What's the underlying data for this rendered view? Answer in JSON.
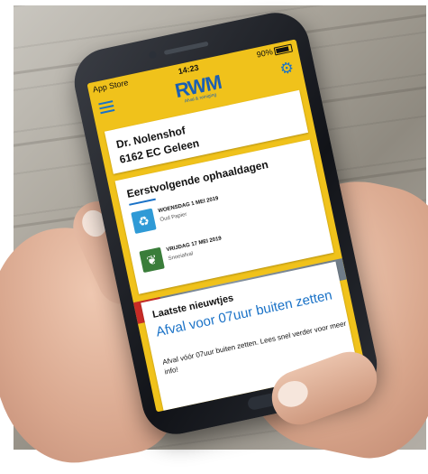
{
  "status_bar": {
    "carrier": "App Store",
    "time": "14:23",
    "battery": "90%"
  },
  "app": {
    "logo_text": "RWM",
    "logo_subtitle": "Afval & reiniging"
  },
  "address": {
    "street": "Dr. Nolenshof",
    "postal_city": "6162 EC Geleen"
  },
  "pickup": {
    "title": "Eerstvolgende ophaaldagen",
    "items": [
      {
        "date": "WOENSDAG 1 MEI 2019",
        "type": "Oud Papier",
        "color": "#2f9ad6"
      },
      {
        "date": "VRIJDAG 17 MEI 2019",
        "type": "Snoeiafval",
        "color": "#3a7d3a"
      }
    ]
  },
  "news": {
    "section_title": "Laatste nieuwtjes",
    "headline": "Afval voor 07uur buiten zetten",
    "body": "Afval vóór 07uur buiten zetten. Lees snel verder voor meer info!"
  },
  "colors": {
    "accent_yellow": "#f0c21b",
    "brand_blue": "#1a72c7"
  }
}
